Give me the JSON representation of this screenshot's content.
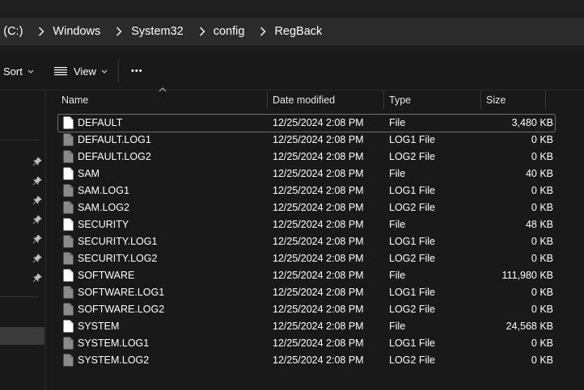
{
  "breadcrumb": {
    "items": [
      "l (C:)",
      "Windows",
      "System32",
      "config",
      "RegBack"
    ]
  },
  "toolbar": {
    "sort_label": "Sort",
    "view_label": "View",
    "more_label": "•••"
  },
  "columns": {
    "name": "Name",
    "date": "Date modified",
    "type": "Type",
    "size": "Size"
  },
  "files": [
    {
      "name": "DEFAULT",
      "date": "12/25/2024 2:08 PM",
      "type": "File",
      "size": "3,480 KB",
      "icon": "blank-file-icon"
    },
    {
      "name": "DEFAULT.LOG1",
      "date": "12/25/2024 2:08 PM",
      "type": "LOG1 File",
      "size": "0 KB",
      "icon": "log-file-icon"
    },
    {
      "name": "DEFAULT.LOG2",
      "date": "12/25/2024 2:08 PM",
      "type": "LOG2 File",
      "size": "0 KB",
      "icon": "log-file-icon"
    },
    {
      "name": "SAM",
      "date": "12/25/2024 2:08 PM",
      "type": "File",
      "size": "40 KB",
      "icon": "blank-file-icon"
    },
    {
      "name": "SAM.LOG1",
      "date": "12/25/2024 2:08 PM",
      "type": "LOG1 File",
      "size": "0 KB",
      "icon": "log-file-icon"
    },
    {
      "name": "SAM.LOG2",
      "date": "12/25/2024 2:08 PM",
      "type": "LOG2 File",
      "size": "0 KB",
      "icon": "log-file-icon"
    },
    {
      "name": "SECURITY",
      "date": "12/25/2024 2:08 PM",
      "type": "File",
      "size": "48 KB",
      "icon": "blank-file-icon"
    },
    {
      "name": "SECURITY.LOG1",
      "date": "12/25/2024 2:08 PM",
      "type": "LOG1 File",
      "size": "0 KB",
      "icon": "log-file-icon"
    },
    {
      "name": "SECURITY.LOG2",
      "date": "12/25/2024 2:08 PM",
      "type": "LOG2 File",
      "size": "0 KB",
      "icon": "log-file-icon"
    },
    {
      "name": "SOFTWARE",
      "date": "12/25/2024 2:08 PM",
      "type": "File",
      "size": "111,980 KB",
      "icon": "blank-file-icon"
    },
    {
      "name": "SOFTWARE.LOG1",
      "date": "12/25/2024 2:08 PM",
      "type": "LOG1 File",
      "size": "0 KB",
      "icon": "log-file-icon"
    },
    {
      "name": "SOFTWARE.LOG2",
      "date": "12/25/2024 2:08 PM",
      "type": "LOG2 File",
      "size": "0 KB",
      "icon": "log-file-icon"
    },
    {
      "name": "SYSTEM",
      "date": "12/25/2024 2:08 PM",
      "type": "File",
      "size": "24,568 KB",
      "icon": "blank-file-icon"
    },
    {
      "name": "SYSTEM.LOG1",
      "date": "12/25/2024 2:08 PM",
      "type": "LOG1 File",
      "size": "0 KB",
      "icon": "log-file-icon"
    },
    {
      "name": "SYSTEM.LOG2",
      "date": "12/25/2024 2:08 PM",
      "type": "LOG2 File",
      "size": "0 KB",
      "icon": "log-file-icon"
    }
  ],
  "colors": {
    "background": "#191919",
    "address_bar": "#2b2b2b",
    "text": "#ffffff",
    "divider": "#3a3a3a"
  }
}
